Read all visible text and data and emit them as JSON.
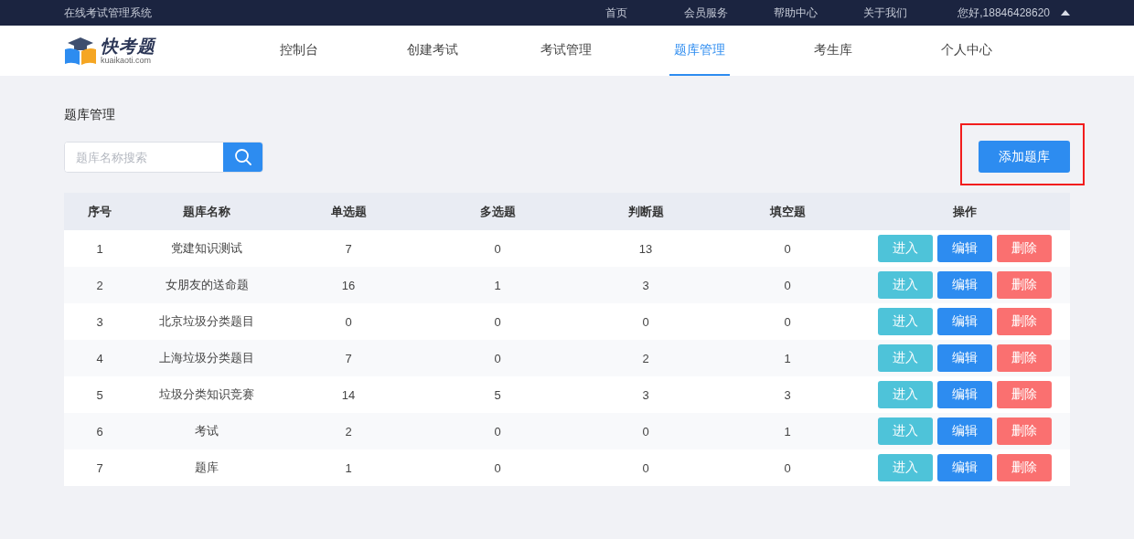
{
  "header": {
    "system_title": "在线考试管理系统",
    "links": [
      "首页",
      "会员服务",
      "帮助中心",
      "关于我们"
    ],
    "user": "您好,18846428620"
  },
  "logo": {
    "name": "快考题",
    "domain": "kuaikaoti.com"
  },
  "nav": {
    "items": [
      {
        "label": "控制台",
        "selected": false
      },
      {
        "label": "创建考试",
        "selected": false
      },
      {
        "label": "考试管理",
        "selected": false
      },
      {
        "label": "题库管理",
        "selected": true
      },
      {
        "label": "考生库",
        "selected": false
      },
      {
        "label": "个人中心",
        "selected": false
      }
    ]
  },
  "page_title": "题库管理",
  "search": {
    "placeholder": "题库名称搜索"
  },
  "add_button": {
    "label": "添加题库",
    "highlighted": true
  },
  "table": {
    "columns": [
      "序号",
      "题库名称",
      "单选题",
      "多选题",
      "判断题",
      "填空题",
      "操作"
    ],
    "rows": [
      {
        "cells": [
          "1",
          "党建知识测试",
          "7",
          "0",
          "13",
          "0"
        ],
        "actions": [
          {
            "kind": "enter",
            "label": "进入"
          },
          {
            "kind": "edit",
            "label": "编辑"
          },
          {
            "kind": "delete",
            "label": "删除"
          }
        ]
      },
      {
        "cells": [
          "2",
          "女朋友的送命题",
          "16",
          "1",
          "3",
          "0"
        ],
        "actions": [
          {
            "kind": "enter",
            "label": "进入"
          },
          {
            "kind": "edit",
            "label": "编辑"
          },
          {
            "kind": "delete",
            "label": "删除"
          }
        ]
      },
      {
        "cells": [
          "3",
          "北京垃圾分类题目",
          "0",
          "0",
          "0",
          "0"
        ],
        "actions": [
          {
            "kind": "enter",
            "label": "进入"
          },
          {
            "kind": "edit",
            "label": "编辑"
          },
          {
            "kind": "delete",
            "label": "删除"
          }
        ]
      },
      {
        "cells": [
          "4",
          "上海垃圾分类题目",
          "7",
          "0",
          "2",
          "1"
        ],
        "actions": [
          {
            "kind": "enter",
            "label": "进入"
          },
          {
            "kind": "edit",
            "label": "编辑"
          },
          {
            "kind": "delete",
            "label": "删除"
          }
        ]
      },
      {
        "cells": [
          "5",
          "垃圾分类知识竞赛",
          "14",
          "5",
          "3",
          "3"
        ],
        "actions": [
          {
            "kind": "enter",
            "label": "进入"
          },
          {
            "kind": "edit",
            "label": "编辑"
          },
          {
            "kind": "delete",
            "label": "删除"
          }
        ]
      },
      {
        "cells": [
          "6",
          "考试",
          "2",
          "0",
          "0",
          "1"
        ],
        "actions": [
          {
            "kind": "enter",
            "label": "进入"
          },
          {
            "kind": "edit",
            "label": "编辑"
          },
          {
            "kind": "delete",
            "label": "删除"
          }
        ]
      },
      {
        "cells": [
          "7",
          "题库",
          "1",
          "0",
          "0",
          "0"
        ],
        "actions": [
          {
            "kind": "enter",
            "label": "进入"
          },
          {
            "kind": "edit",
            "label": "编辑"
          },
          {
            "kind": "delete",
            "label": "删除"
          }
        ]
      }
    ]
  }
}
